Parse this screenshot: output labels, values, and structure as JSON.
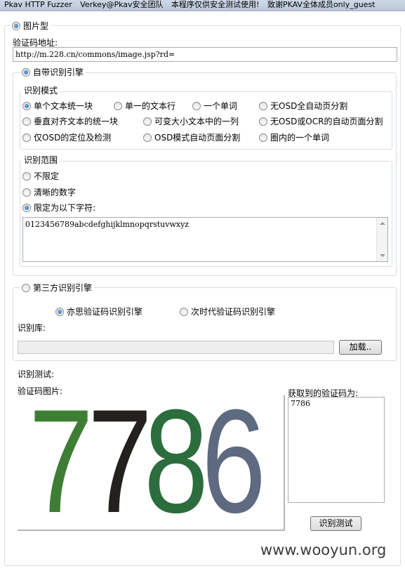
{
  "window": {
    "title_parts": [
      "Pkav HTTP Fuzzer",
      "Verkey@Pkav安全团队",
      "本程序仅供安全测试使用!",
      "致谢PKAV全体成员only_guest"
    ]
  },
  "image_type": {
    "label": "图片型",
    "selected": true
  },
  "url_field": {
    "label": "验证码地址:",
    "value": "http://m.228.cn/commons/image.jsp?rd="
  },
  "builtin_engine": {
    "label": "自带识别引擎",
    "selected": true,
    "mode_group": {
      "label": "识别模式",
      "options": [
        {
          "label": "单个文本统一块",
          "selected": true
        },
        {
          "label": "单一的文本行",
          "selected": false
        },
        {
          "label": "一个单词",
          "selected": false
        },
        {
          "label": "无OSD全自动页分割",
          "selected": false
        },
        {
          "label": "垂直对齐文本的统一块",
          "selected": false
        },
        {
          "label": "可变大小文本中的一列",
          "selected": false
        },
        {
          "label": "无OSD或OCR的自动页面分割",
          "selected": false
        },
        {
          "label": "仅OSD的定位及检测",
          "selected": false
        },
        {
          "label": "OSD模式自动页面分割",
          "selected": false
        },
        {
          "label": "圈内的一个单词",
          "selected": false
        }
      ]
    },
    "range_group": {
      "label": "识别范围",
      "options": [
        {
          "label": "不限定",
          "selected": false
        },
        {
          "label": "清晰的数字",
          "selected": false
        },
        {
          "label": "限定为以下字符:",
          "selected": true
        }
      ],
      "chars": "0123456789abcdefghijklmnopqrstuvwxyz"
    }
  },
  "third_party_engine": {
    "label": "第三方识别引擎",
    "selected": false,
    "options": [
      {
        "label": "亦思验证码识别引擎",
        "selected": true
      },
      {
        "label": "次时代验证码识别引擎",
        "selected": false
      }
    ],
    "library_label": "识别库:",
    "library_value": "",
    "load_button": "加载.."
  },
  "test": {
    "section_label": "识别测试:",
    "image_label": "验证码图片:",
    "captcha_digits": [
      "7",
      "7",
      "8",
      "6"
    ],
    "captcha_colors": [
      "#3e7e34",
      "#23211d",
      "#2b6d3c",
      "#5e6a80"
    ],
    "result_label": "获取到的验证码为:",
    "result_value": "7786",
    "test_button": "识别测试"
  },
  "watermark": "www.wooyun.org"
}
